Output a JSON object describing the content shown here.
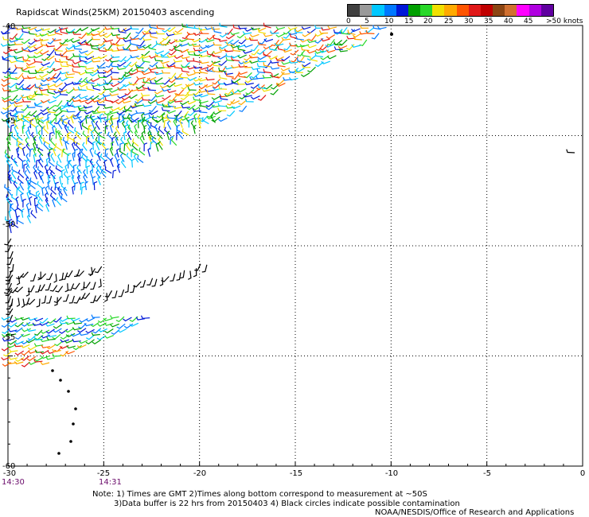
{
  "title": "Rapidscat Winds(25KM) 20150403 ascending",
  "scale": {
    "labels": [
      "0",
      "5",
      "10",
      "15",
      "20",
      "25",
      "30",
      "35",
      "40",
      "45",
      ">50 knots"
    ],
    "colors": [
      "#404040",
      "#9a9a9a",
      "#00c8ff",
      "#0078ff",
      "#0018d8",
      "#00a000",
      "#28d828",
      "#f0e000",
      "#ffaa00",
      "#ff5500",
      "#e01818",
      "#c00000",
      "#8b4513",
      "#d07030",
      "#ff00ff",
      "#b000e0",
      "#6000a0"
    ]
  },
  "map": {
    "lon_ticks": [
      "-30",
      "-25",
      "-20",
      "-15",
      "-10",
      "-5",
      "0"
    ],
    "lat_ticks": [
      "-40",
      "-45",
      "-50",
      "-55",
      "-60"
    ],
    "times": [
      "14:30",
      "14:31"
    ]
  },
  "notes": {
    "line1": "Note: 1) Times are GMT 2)Times along bottom correspond to measurement at ~50S",
    "line2": "3)Data buffer is 22 hrs from 20150403 4) Black circles indicate possible contamination",
    "line3": "NOAA/NESDIS/Office of Research and Applications"
  }
}
